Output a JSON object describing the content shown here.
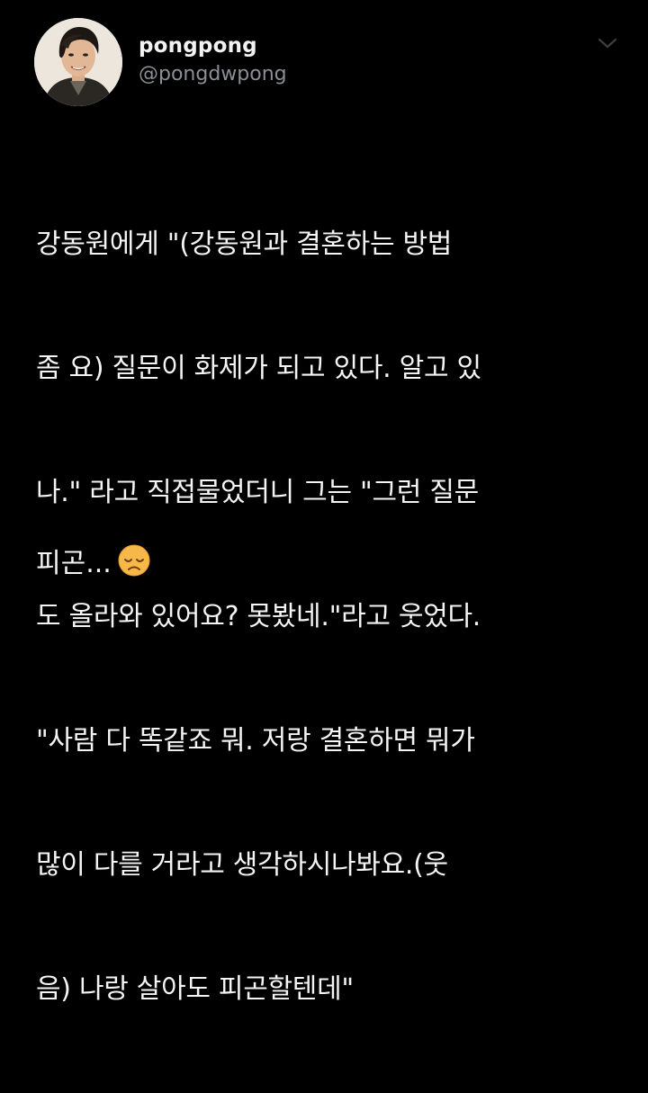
{
  "tweet": {
    "display_name": "pongpong",
    "handle": "@pongdwpong",
    "menu_icon": "chevron-down-icon",
    "body_lines": [
      "강동원에게 \"(강동원과 결혼하는 방법",
      "좀 요) 질문이 화제가 되고 있다. 알고 있",
      "나.\" 라고 직접물었더니 그는 \"그런 질문",
      "도 올라와 있어요? 못봤네.\"라고 웃었다.",
      "\"사람 다 똑같죠 뭐. 저랑 결혼하면 뭐가",
      "많이 다를 거라고 생각하시나봐요.(웃",
      "음) 나랑 살아도 피곤할텐데\""
    ],
    "followup_text": "피곤...",
    "followup_emoji": "disappointed-face-icon"
  },
  "colors": {
    "background": "#000000",
    "text": "#f4f4f4",
    "handle": "#8a8f94",
    "emoji_face": "#f7b84a"
  }
}
